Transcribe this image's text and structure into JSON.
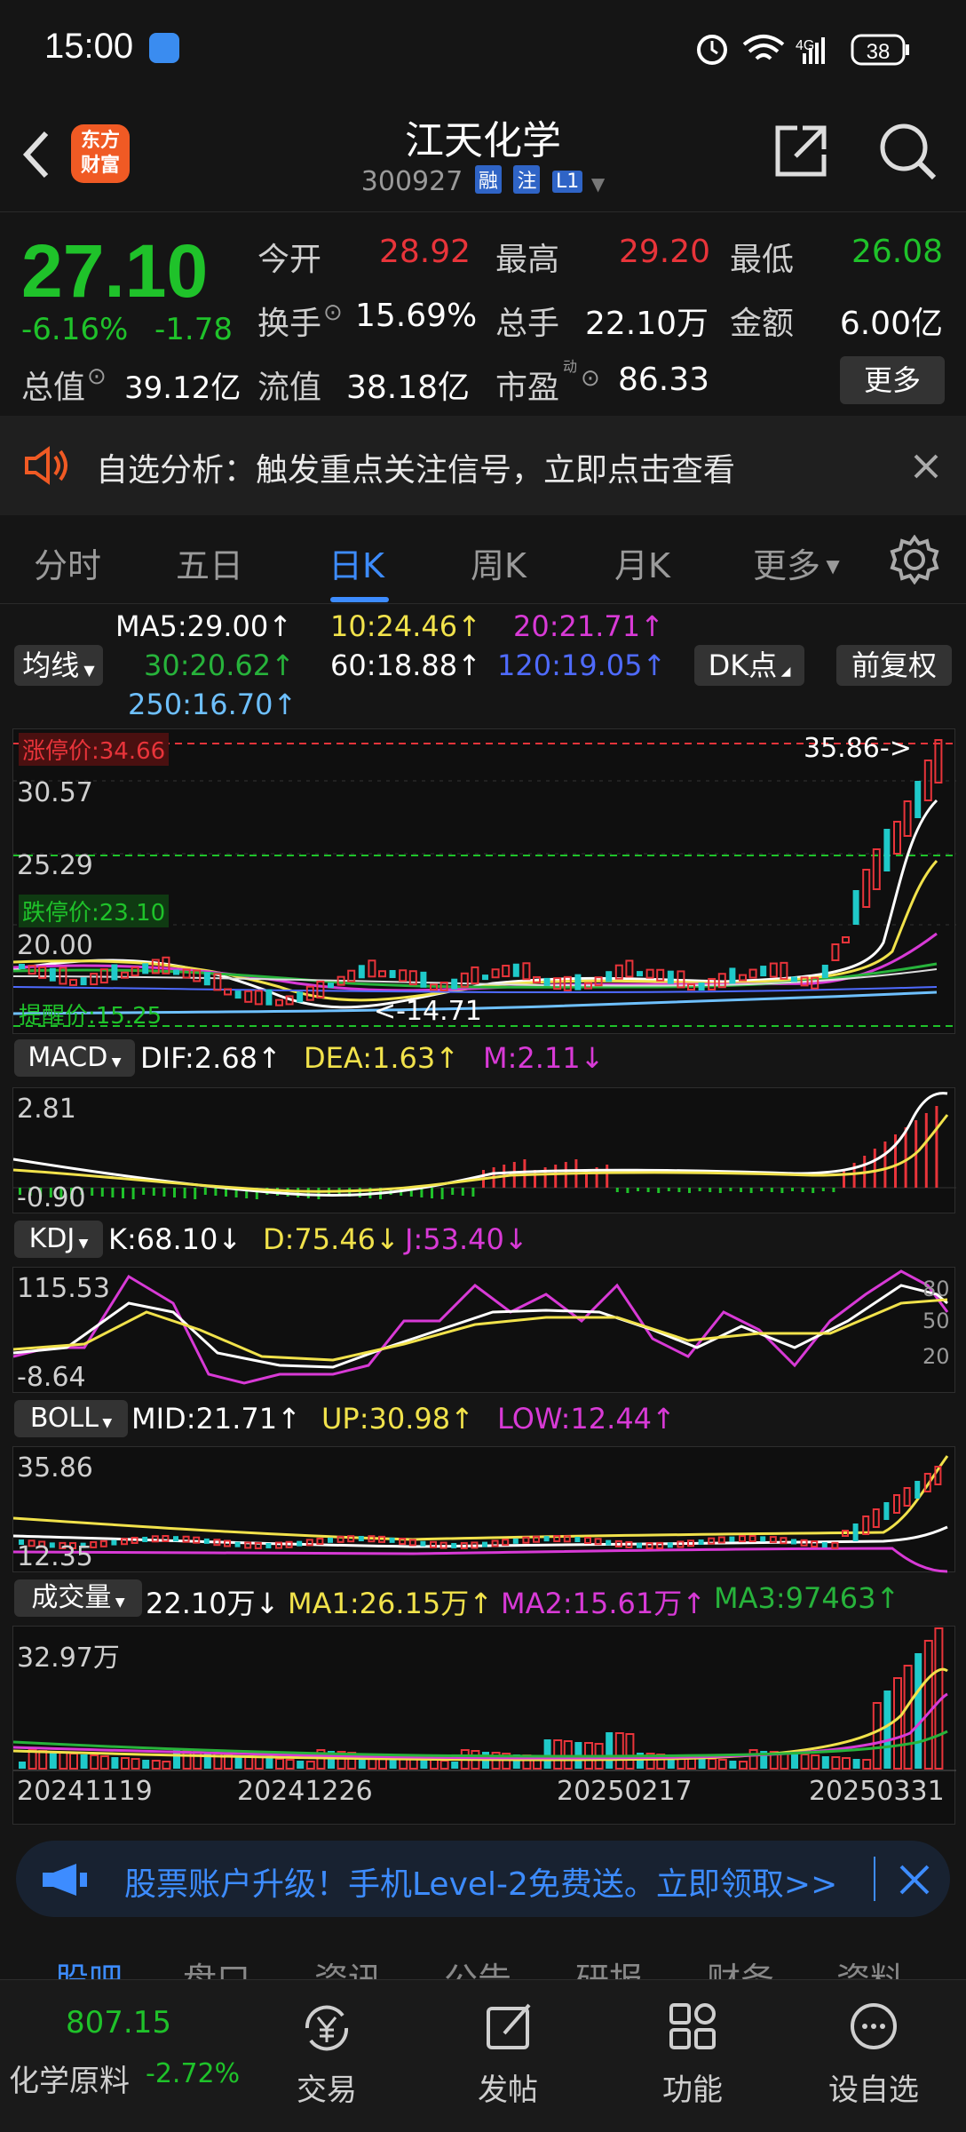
{
  "status": {
    "time": "15:00",
    "network": "4G",
    "battery": "38"
  },
  "header": {
    "back_icon": "back-arrow-icon",
    "logo_text_line1": "东方",
    "logo_text_line2": "财富",
    "title": "江天化学",
    "code": "300927",
    "tag1": "融",
    "tag2": "注",
    "tag3": "L1"
  },
  "quote": {
    "price": "27.10",
    "change_pct": "-6.16%",
    "change": "-1.78",
    "open_label": "今开",
    "open": "28.92",
    "high_label": "最高",
    "high": "29.20",
    "low_label": "最低",
    "low": "26.08",
    "turnover_label": "换手",
    "turnover": "15.69%",
    "volume_label": "总手",
    "volume": "22.10万",
    "amount_label": "金额",
    "amount": "6.00亿",
    "mktcap_label": "总值",
    "mktcap": "39.12亿",
    "float_label": "流值",
    "float": "38.18亿",
    "pe_label": "市盈",
    "pe_sup": "动",
    "pe": "86.33",
    "more_button": "更多"
  },
  "notice": {
    "text": "自选分析：触发重点关注信号，立即点击查看"
  },
  "tabs": [
    "分时",
    "五日",
    "日K",
    "周K",
    "月K",
    "更多"
  ],
  "ma_legend": {
    "type_button": "均线",
    "ma5": "MA5:29.00↑",
    "ma10": "10:24.46↑",
    "ma20": "20:21.71↑",
    "ma30": "30:20.62↑",
    "ma60": "60:18.88↑",
    "ma120": "120:19.05↑",
    "ma250": "250:16.70↑",
    "dk_button": "DK点",
    "adjust_button": "前复权"
  },
  "main_chart": {
    "limit_up": "涨停价:34.66",
    "y_top": "35.86",
    "y2": "30.57",
    "y3": "25.29",
    "limit_down": "跌停价:23.10",
    "y4": "20.00",
    "remind": "提醒价:15.25",
    "max_annot": "35.86->",
    "min_annot": "<-14.71"
  },
  "macd": {
    "label": "MACD",
    "dif": "DIF:2.68↑",
    "dea": "DEA:1.63↑",
    "m": "M:2.11↓",
    "y_top": "2.81",
    "y_bot": "-0.90"
  },
  "kdj": {
    "label": "KDJ",
    "k": "K:68.10↓",
    "d": "D:75.46↓",
    "j": "J:53.40↓",
    "y_top": "115.53",
    "y_bot": "-8.64",
    "r80": "80",
    "r50": "50",
    "r20": "20"
  },
  "boll": {
    "label": "BOLL",
    "mid": "MID:21.71↑",
    "up": "UP:30.98↑",
    "low": "LOW:12.44↑",
    "y_top": "35.86",
    "y_bot": "12.35"
  },
  "vol": {
    "label": "成交量",
    "vol": "22.10万↓",
    "ma1": "MA1:26.15万↑",
    "ma2": "MA2:15.61万↑",
    "ma3": "MA3:97463↑",
    "y_top": "32.97万"
  },
  "dates": [
    "20241119",
    "20241226",
    "20250217",
    "20250331"
  ],
  "banner": {
    "text": "股票账户升级！手机Level-2免费送。立即领取>>"
  },
  "subtabs": [
    "股吧",
    "盘口",
    "资讯",
    "公告",
    "研报",
    "财务",
    "资料"
  ],
  "bottom": {
    "index_value": "807.15",
    "index_name": "化学原料",
    "index_change": "-2.72%",
    "trade": "交易",
    "post": "发帖",
    "function": "功能",
    "watch": "设自选"
  },
  "colors": {
    "up": "#e8343a",
    "down": "#1fc22a",
    "accent": "#3d8cff"
  }
}
